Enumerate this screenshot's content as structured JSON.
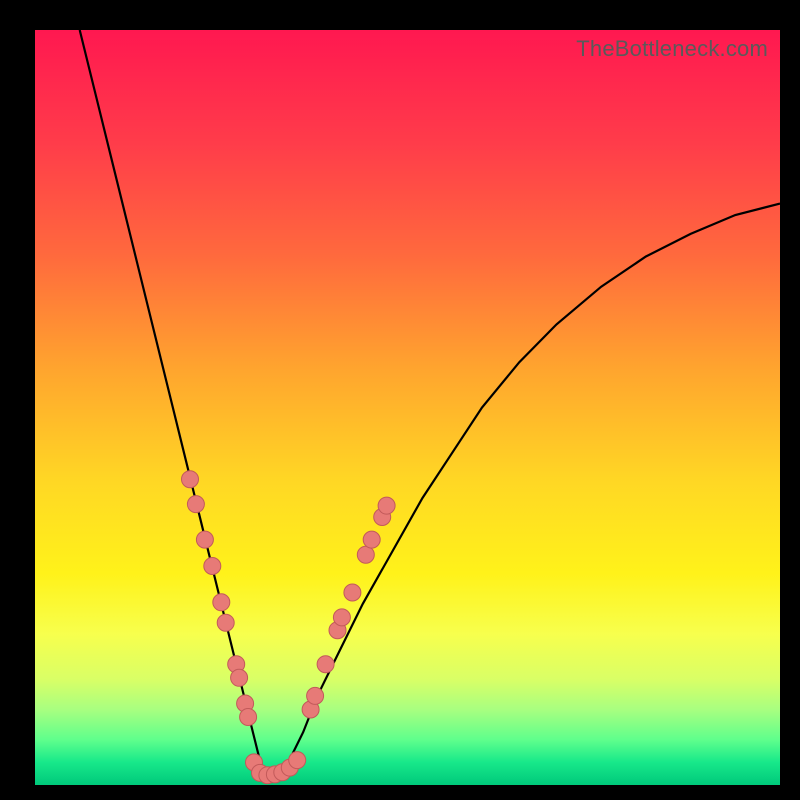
{
  "watermark": "TheBottleneck.com",
  "colors": {
    "gradient_top": "#ff1850",
    "gradient_bottom": "#00c97b",
    "curve": "#000000",
    "dots": "#e77a77",
    "frame": "#000000"
  },
  "chart_data": {
    "type": "line",
    "title": "",
    "xlabel": "",
    "ylabel": "",
    "xlim": [
      0,
      100
    ],
    "ylim": [
      0,
      100
    ],
    "curve": {
      "description": "Bottleneck-style V-curve; left branch descends steeply from top-left, minimum near x≈31 at y≈0, right branch rises with concave-down arc toward upper-right",
      "x": [
        6,
        8,
        10,
        12,
        14,
        16,
        18,
        20,
        22,
        24,
        26,
        28,
        29,
        30,
        31,
        32,
        33,
        34,
        36,
        38,
        41,
        44,
        48,
        52,
        56,
        60,
        65,
        70,
        76,
        82,
        88,
        94,
        100
      ],
      "y": [
        100,
        92,
        84,
        76,
        68,
        60,
        52,
        44,
        36,
        28,
        20,
        12,
        8,
        4,
        1,
        0.5,
        1,
        3,
        7,
        12,
        18,
        24,
        31,
        38,
        44,
        50,
        56,
        61,
        66,
        70,
        73,
        75.5,
        77
      ]
    },
    "dot_clusters": [
      {
        "name": "left-branch-dots",
        "points": [
          {
            "x": 20.8,
            "y": 40.5
          },
          {
            "x": 21.6,
            "y": 37.2
          },
          {
            "x": 22.8,
            "y": 32.5
          },
          {
            "x": 23.8,
            "y": 29.0
          },
          {
            "x": 25.0,
            "y": 24.2
          },
          {
            "x": 25.6,
            "y": 21.5
          },
          {
            "x": 27.0,
            "y": 16.0
          },
          {
            "x": 27.4,
            "y": 14.2
          },
          {
            "x": 28.2,
            "y": 10.8
          },
          {
            "x": 28.6,
            "y": 9.0
          }
        ]
      },
      {
        "name": "valley-dots",
        "points": [
          {
            "x": 29.4,
            "y": 3.0
          },
          {
            "x": 30.2,
            "y": 1.6
          },
          {
            "x": 31.2,
            "y": 1.3
          },
          {
            "x": 32.2,
            "y": 1.4
          },
          {
            "x": 33.2,
            "y": 1.7
          },
          {
            "x": 34.2,
            "y": 2.3
          },
          {
            "x": 35.2,
            "y": 3.3
          }
        ]
      },
      {
        "name": "right-branch-dots",
        "points": [
          {
            "x": 37.0,
            "y": 10.0
          },
          {
            "x": 37.6,
            "y": 11.8
          },
          {
            "x": 39.0,
            "y": 16.0
          },
          {
            "x": 40.6,
            "y": 20.5
          },
          {
            "x": 41.2,
            "y": 22.2
          },
          {
            "x": 42.6,
            "y": 25.5
          },
          {
            "x": 44.4,
            "y": 30.5
          },
          {
            "x": 45.2,
            "y": 32.5
          },
          {
            "x": 46.6,
            "y": 35.5
          },
          {
            "x": 47.2,
            "y": 37.0
          }
        ]
      }
    ]
  }
}
